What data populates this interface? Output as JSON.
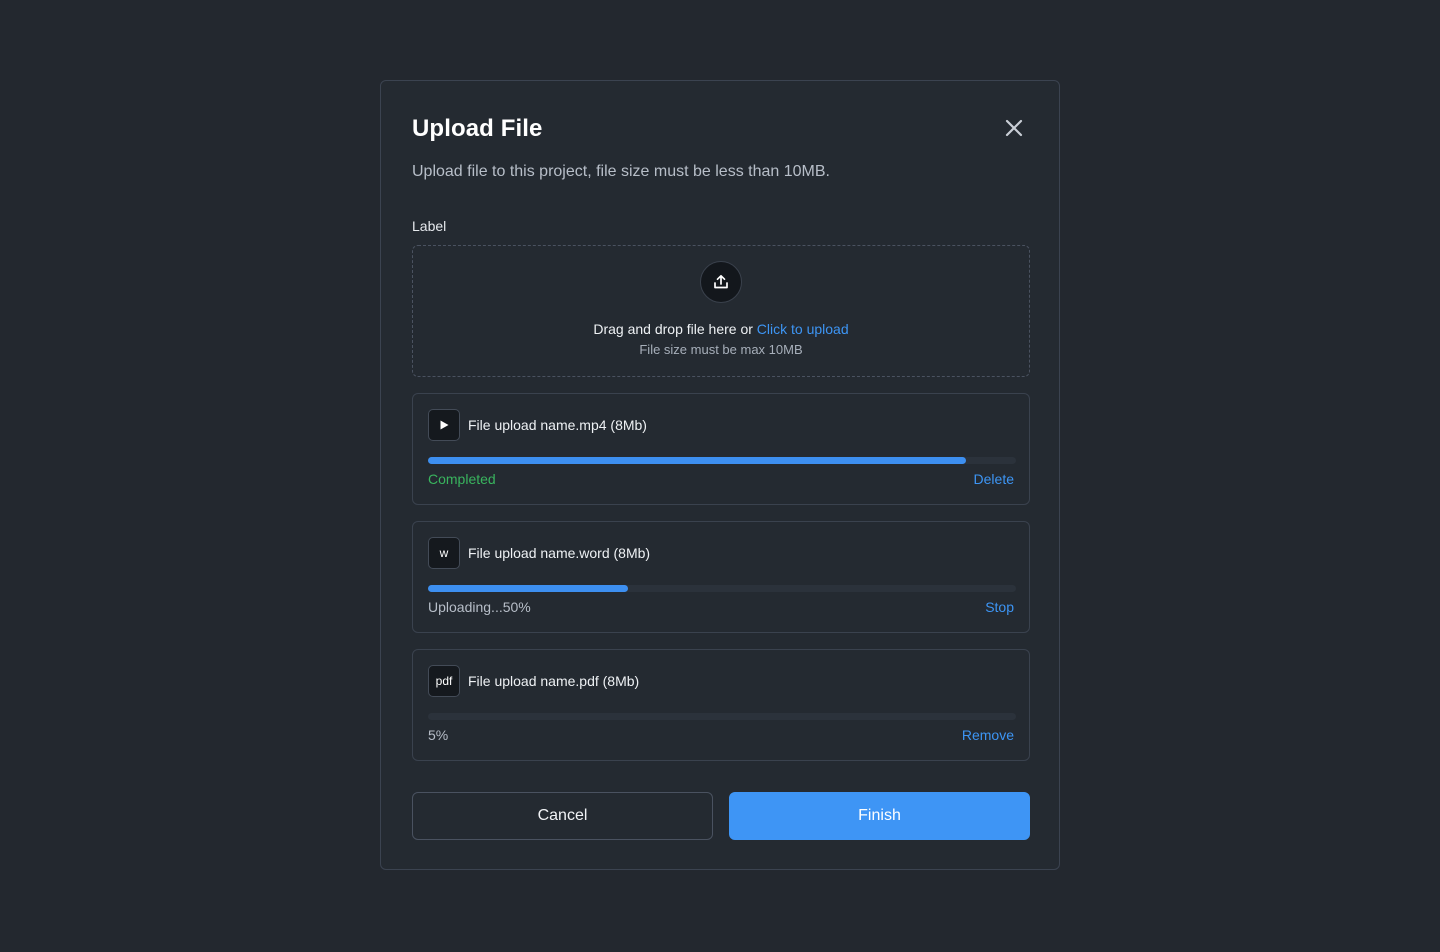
{
  "dialog": {
    "title": "Upload File",
    "subtitle": "Upload file to this project, file size must be less than 10MB.",
    "field_label": "Label"
  },
  "dropzone": {
    "prompt_text": "Drag and drop file here or",
    "link_text": "Click to upload",
    "hint": "File size must be max 10MB"
  },
  "files": [
    {
      "icon": "play-icon",
      "icon_text": "",
      "name": "File upload name.mp4 (8Mb)",
      "progress": 0.915,
      "status": "Completed",
      "action": "Delete"
    },
    {
      "icon": "word-icon",
      "icon_text": "w",
      "name": "File upload name.word (8Mb)",
      "progress": 0.34,
      "status": "Uploading...50%",
      "action": "Stop"
    },
    {
      "icon": "pdf-icon",
      "icon_text": "pdf",
      "name": "File upload name.pdf (8Mb)",
      "progress": 0.0,
      "status": "5%",
      "action": "Remove"
    }
  ],
  "buttons": {
    "cancel": "Cancel",
    "finish": "Finish"
  },
  "colors": {
    "accent": "#3e95f5",
    "success": "#39b45e",
    "background": "#23282f"
  }
}
